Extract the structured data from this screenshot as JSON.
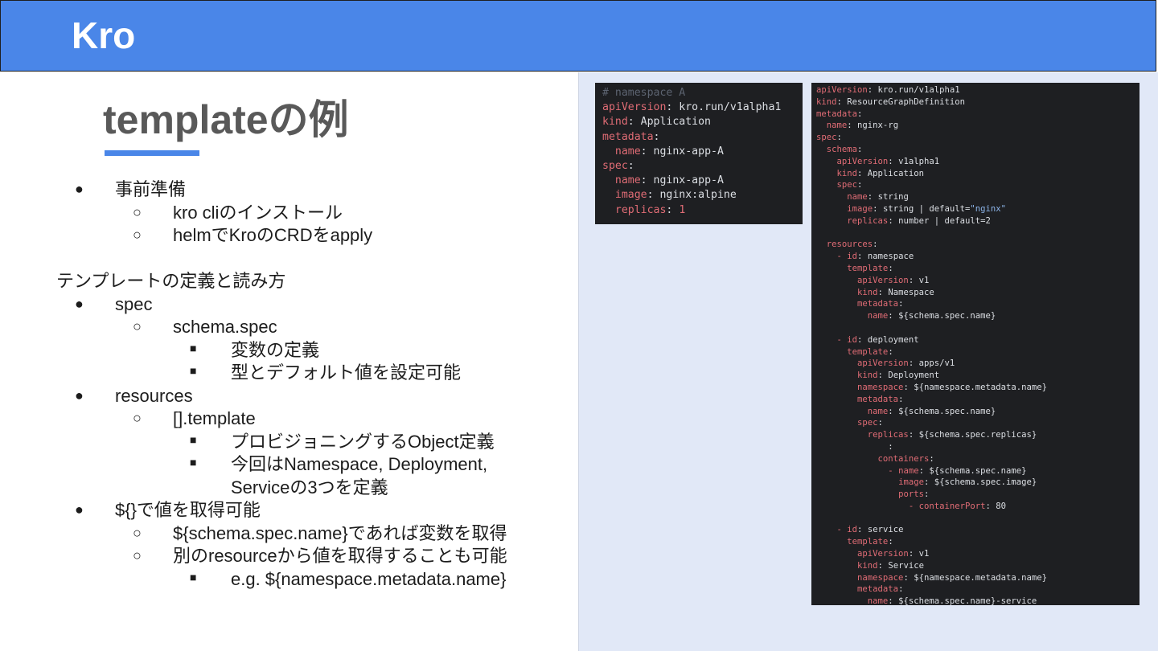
{
  "header": {
    "title": "Kro"
  },
  "slide": {
    "title": "templateの例"
  },
  "bullets": [
    {
      "level": 1,
      "marker": "●",
      "text": "事前準備"
    },
    {
      "level": 2,
      "marker": "○",
      "text": "kro cliのインストール"
    },
    {
      "level": 2,
      "marker": "○",
      "text": "helmでKroのCRDをapply"
    },
    {
      "level": 0,
      "marker": "",
      "text": ""
    },
    {
      "level": 0,
      "marker": "",
      "text": "テンプレートの定義と読み方"
    },
    {
      "level": 1,
      "marker": "●",
      "text": "spec"
    },
    {
      "level": 2,
      "marker": "○",
      "text": "schema.spec"
    },
    {
      "level": 3,
      "marker": "■",
      "text": "変数の定義"
    },
    {
      "level": 3,
      "marker": "■",
      "text": "型とデフォルト値を設定可能"
    },
    {
      "level": 1,
      "marker": "●",
      "text": "resources"
    },
    {
      "level": 2,
      "marker": "○",
      "text": "[].template"
    },
    {
      "level": 3,
      "marker": "■",
      "text": "プロビジョニングするObject定義"
    },
    {
      "level": 3,
      "marker": "■",
      "text": "今回はNamespace, Deployment,"
    },
    {
      "level": 3,
      "marker": "",
      "text": "Serviceの3つを定義"
    },
    {
      "level": 1,
      "marker": "●",
      "text": "${}で値を取得可能"
    },
    {
      "level": 2,
      "marker": "○",
      "text": "${schema.spec.name}であれば変数を取得"
    },
    {
      "level": 2,
      "marker": "○",
      "text": "別のresourceから値を取得することも可能"
    },
    {
      "level": 3,
      "marker": "■",
      "text": "e.g. ${namespace.metadata.name}"
    }
  ],
  "code_small": [
    {
      "indent": "",
      "comment": "# namespace A"
    },
    {
      "indent": "",
      "key": "apiVersion",
      "value": "kro.run/v1alpha1"
    },
    {
      "indent": "",
      "key": "kind",
      "value": "Application"
    },
    {
      "indent": "",
      "key": "metadata",
      "value": ""
    },
    {
      "indent": "  ",
      "key": "name",
      "value": "nginx-app-A"
    },
    {
      "indent": "",
      "key": "spec",
      "value": ""
    },
    {
      "indent": "  ",
      "key": "name",
      "value": "nginx-app-A"
    },
    {
      "indent": "  ",
      "key": "image",
      "value": "nginx:alpine"
    },
    {
      "indent": "  ",
      "key": "replicas",
      "number": "1"
    }
  ],
  "code_large": [
    {
      "indent": "",
      "key": "apiVersion",
      "value": "kro.run/v1alpha1"
    },
    {
      "indent": "",
      "key": "kind",
      "value": "ResourceGraphDefinition"
    },
    {
      "indent": "",
      "key": "metadata",
      "value": ""
    },
    {
      "indent": "  ",
      "key": "name",
      "value": "nginx-rg"
    },
    {
      "indent": "",
      "key": "spec",
      "value": ""
    },
    {
      "indent": "  ",
      "key": "schema",
      "value": ""
    },
    {
      "indent": "    ",
      "key": "apiVersion",
      "value": "v1alpha1"
    },
    {
      "indent": "    ",
      "key": "kind",
      "value": "Application"
    },
    {
      "indent": "    ",
      "key": "spec",
      "value": ""
    },
    {
      "indent": "      ",
      "key": "name",
      "value": "string"
    },
    {
      "indent": "      ",
      "key": "image",
      "value": "string | default=",
      "string": "\"nginx\""
    },
    {
      "indent": "      ",
      "key": "replicas",
      "value": "number | default=2"
    },
    {
      "indent": "",
      "value": ""
    },
    {
      "indent": "  ",
      "key": "resources",
      "value": ""
    },
    {
      "indent": "    ",
      "dash": "- ",
      "key": "id",
      "value": "namespace"
    },
    {
      "indent": "      ",
      "key": "template",
      "value": ""
    },
    {
      "indent": "        ",
      "key": "apiVersion",
      "value": "v1"
    },
    {
      "indent": "        ",
      "key": "kind",
      "value": "Namespace"
    },
    {
      "indent": "        ",
      "key": "metadata",
      "value": ""
    },
    {
      "indent": "          ",
      "key": "name",
      "value": "${schema.spec.name}"
    },
    {
      "indent": "",
      "value": ""
    },
    {
      "indent": "    ",
      "dash": "- ",
      "key": "id",
      "value": "deployment"
    },
    {
      "indent": "      ",
      "key": "template",
      "value": ""
    },
    {
      "indent": "        ",
      "key": "apiVersion",
      "value": "apps/v1"
    },
    {
      "indent": "        ",
      "key": "kind",
      "value": "Deployment"
    },
    {
      "indent": "        ",
      "key": "namespace",
      "value": "${namespace.metadata.name}"
    },
    {
      "indent": "        ",
      "key": "metadata",
      "value": ""
    },
    {
      "indent": "          ",
      "key": "name",
      "value": "${schema.spec.name}"
    },
    {
      "indent": "        ",
      "key": "spec",
      "value": ""
    },
    {
      "indent": "          ",
      "key": "replicas",
      "value": "${schema.spec.replicas}"
    },
    {
      "indent": "              ",
      "plain": ":"
    },
    {
      "indent": "            ",
      "key": "containers",
      "value": ""
    },
    {
      "indent": "              ",
      "dash": "- ",
      "key": "name",
      "value": "${schema.spec.name}"
    },
    {
      "indent": "                ",
      "key": "image",
      "value": "${schema.spec.image}"
    },
    {
      "indent": "                ",
      "key": "ports",
      "value": ""
    },
    {
      "indent": "                  ",
      "dash": "- ",
      "key": "containerPort",
      "value": "80"
    },
    {
      "indent": "",
      "value": ""
    },
    {
      "indent": "    ",
      "dash": "- ",
      "key": "id",
      "value": "service"
    },
    {
      "indent": "      ",
      "key": "template",
      "value": ""
    },
    {
      "indent": "        ",
      "key": "apiVersion",
      "value": "v1"
    },
    {
      "indent": "        ",
      "key": "kind",
      "value": "Service"
    },
    {
      "indent": "        ",
      "key": "namespace",
      "value": "${namespace.metadata.name}"
    },
    {
      "indent": "        ",
      "key": "metadata",
      "value": ""
    },
    {
      "indent": "          ",
      "key": "name",
      "value": "${schema.spec.name}-service"
    }
  ]
}
